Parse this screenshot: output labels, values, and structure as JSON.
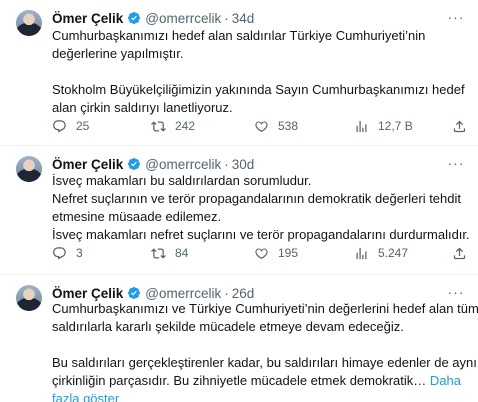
{
  "tweets": [
    {
      "name": "Ömer Çelik",
      "handle": "@omerrcelik",
      "dot": "·",
      "time": "34d",
      "more": "···",
      "lines": [
        "Cumhurbaşkanımızı hedef alan saldırılar Türkiye Cumhuriyeti’nin",
        "değerlerine yapılmıştır.",
        "",
        "Stokholm Büyükelçiliğimizin yakınında Sayın Cumhurbaşkanımızı hedef",
        "alan çirkin saldırıyı lanetliyoruz."
      ],
      "stats": {
        "replies": "25",
        "retweets": "242",
        "likes": "538",
        "views": "12,7 B"
      }
    },
    {
      "name": "Ömer Çelik",
      "handle": "@omerrcelik",
      "dot": "·",
      "time": "30d",
      "more": "···",
      "lines": [
        "İsveç makamları bu saldırılardan sorumludur.",
        "Nefret suçlarının ve terör propagandalarının demokratik değerleri tehdit",
        "etmesine müsaade edilemez.",
        "İsveç makamları nefret suçlarını ve terör propagandalarını durdurmalıdır."
      ],
      "stats": {
        "replies": "3",
        "retweets": "84",
        "likes": "195",
        "views": "5.247"
      }
    },
    {
      "name": "Ömer Çelik",
      "handle": "@omerrcelik",
      "dot": "·",
      "time": "26d",
      "more": "···",
      "lines": [
        "Cumhurbaşkanımızı ve Türkiye Cumhuriyeti’nin değerlerini hedef alan tüm",
        "saldırılarla kararlı şekilde mücadele etmeye devam edeceğiz.",
        "",
        "Bu saldırıları gerçekleştirenler kadar, bu saldırıları himaye edenler de aynı",
        "çirkinliğin parçasıdır. Bu zihniyetle mücadele etmek demokratik…"
      ],
      "show_more_1": "Daha",
      "show_more_2": "fazla göster"
    }
  ],
  "colors": {
    "accent": "#1d9bf0",
    "secondary": "#536471",
    "text": "#0f1419"
  }
}
